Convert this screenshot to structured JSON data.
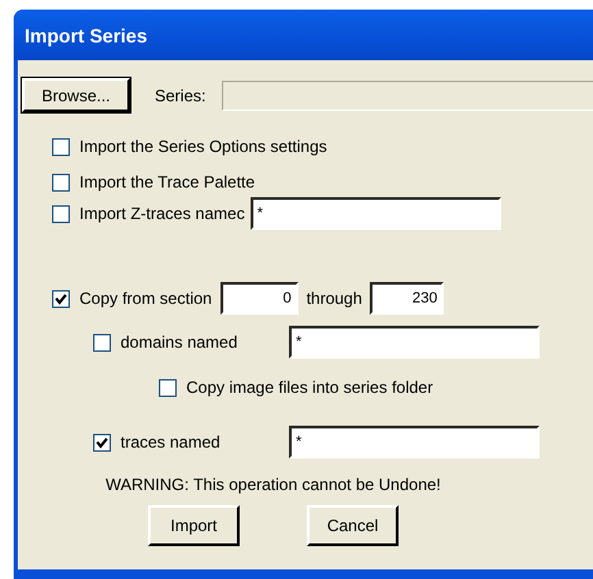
{
  "window": {
    "title": "Import Series"
  },
  "browse_button": "Browse...",
  "series": {
    "label": "Series:",
    "disabled": true
  },
  "import_options": [
    {
      "label": "Import the Series Options settings",
      "checked": false
    },
    {
      "label": "Import the Trace Palette",
      "checked": false
    },
    {
      "label": "Import Z-traces namec",
      "checked": false,
      "value": "*"
    }
  ],
  "copy_sections": {
    "label": "Copy from section",
    "checked": true,
    "from": "0",
    "through_label": "through",
    "to": "230"
  },
  "domains": {
    "label": "domains named",
    "checked": false,
    "value": "*"
  },
  "copy_images": {
    "label": "Copy image files into series folder",
    "checked": false
  },
  "traces": {
    "label": "traces named",
    "checked": true,
    "value": "*"
  },
  "warning": "WARNING: This operation cannot be Undone!",
  "buttons": [
    "Import",
    "Cancel"
  ]
}
